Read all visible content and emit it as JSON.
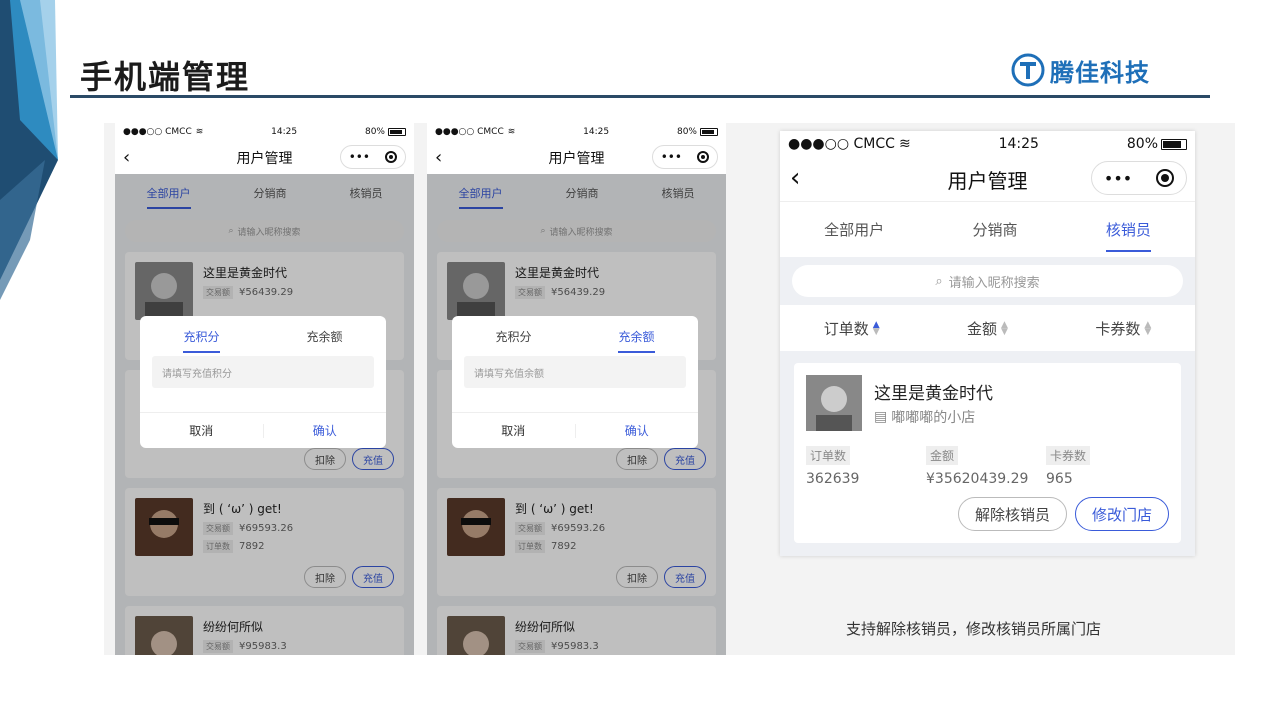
{
  "slide": {
    "title": "手机端管理",
    "logo_text": "腾佳科技",
    "caption": "支持解除核销员，修改核销员所属门店"
  },
  "status": {
    "carrier": "●●●○○ CMCC",
    "time": "14:25",
    "battery": "80%"
  },
  "nav": {
    "back": "‹",
    "title": "用户管理",
    "menu": "•••"
  },
  "tabs": [
    "全部用户",
    "分销商",
    "核销员"
  ],
  "search_placeholder": "请输入昵称搜索",
  "list_users": [
    {
      "name": "这里是黄金时代",
      "trade_label": "交易额",
      "trade_value": "¥56439.29"
    },
    {
      "name": "到 ( ‘ω’ ) get!",
      "trade_label": "交易额",
      "trade_value": "¥69593.26",
      "order_label": "订单数",
      "order_value": "7892"
    },
    {
      "name": "纷纷何所似",
      "trade_label": "交易额",
      "trade_value": "¥95983.3"
    }
  ],
  "list_buttons": {
    "deduct": "扣除",
    "recharge": "充值"
  },
  "dialog1": {
    "tab_points": "充积分",
    "tab_balance": "充余额",
    "placeholder": "请填写充值积分",
    "cancel": "取消",
    "confirm": "确认"
  },
  "dialog2": {
    "tab_points": "充积分",
    "tab_balance": "充余额",
    "placeholder": "请填写充值余额",
    "cancel": "取消",
    "confirm": "确认"
  },
  "big": {
    "sort": [
      "订单数",
      "金额",
      "卡券数"
    ],
    "card": {
      "name": "这里是黄金时代",
      "shop": "嘟嘟嘟的小店",
      "stats": [
        {
          "label": "订单数",
          "value": "362639"
        },
        {
          "label": "金额",
          "value": "¥35620439.29"
        },
        {
          "label": "卡券数",
          "value": "965"
        }
      ],
      "btn_unbind": "解除核销员",
      "btn_modify": "修改门店"
    }
  },
  "colors": {
    "accent": "#3a5bd9",
    "rule": "#2a4a66",
    "logo": "#1e6fb8"
  }
}
